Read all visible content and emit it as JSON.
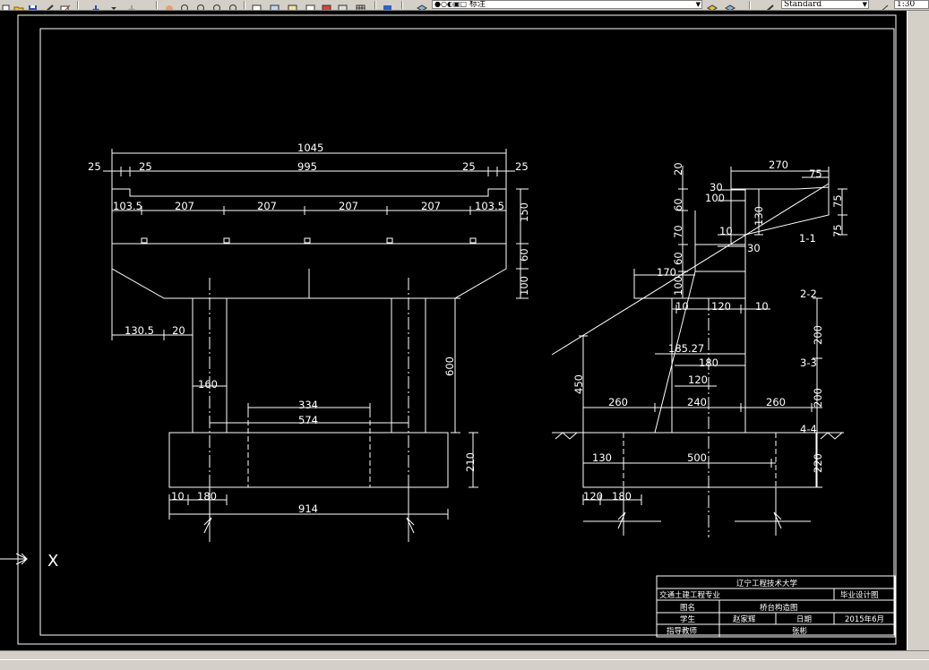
{
  "toolbar": {
    "layer_name": "标注",
    "text_style": "Standard",
    "scale_value": "1:30"
  },
  "axis_label": "X",
  "front_view": {
    "dims": {
      "d1045": "1045",
      "d25a": "25",
      "d25b": "25",
      "d995": "995",
      "d25c": "25",
      "d25d": "25",
      "d103a": "103.5",
      "d207a": "207",
      "d207b": "207",
      "d207c": "207",
      "d207d": "207",
      "d103b": "103.5",
      "d150": "150",
      "d60": "60",
      "d100": "100",
      "d130_5": "130.5",
      "d20": "20",
      "d600": "600",
      "d160": "160",
      "d334": "334",
      "d574": "574",
      "d210": "210",
      "d10": "10",
      "d180": "180",
      "d914": "914"
    }
  },
  "side_view": {
    "dims": {
      "d270": "270",
      "d75a": "75",
      "d30a": "30",
      "d100a": "100",
      "d20": "20",
      "d60a": "60",
      "d70": "70",
      "d10a": "10",
      "d130": "130",
      "d30b": "30",
      "d60b": "60",
      "d100b": "100",
      "d170": "170",
      "d75b": "75",
      "d75c": "75",
      "label_1_1": "1-1",
      "d10b": "10",
      "d120a": "120",
      "d10c": "10",
      "label_2_2": "2-2",
      "d200a": "200",
      "d185": "185.27",
      "d180a": "180",
      "d120b": "120",
      "label_3_3": "3-3",
      "d450": "450",
      "d260a": "260",
      "d240": "240",
      "d260b": "260",
      "d200b": "200",
      "label_4_4": "4-4",
      "d130b": "130",
      "d500": "500",
      "d220": "220",
      "d120c": "120",
      "d180b": "180"
    }
  },
  "title_block": {
    "university": "辽宁工程技术大学",
    "major": "交通土建工程专业",
    "doc_type": "毕业设计图",
    "drawing_name_label": "图名",
    "drawing_name": "桥台构造图",
    "student_label": "学生",
    "student": "赵家辉",
    "date_label": "日期",
    "date": "2015年6月",
    "advisor_label": "指导教师",
    "advisor": "张彬"
  }
}
